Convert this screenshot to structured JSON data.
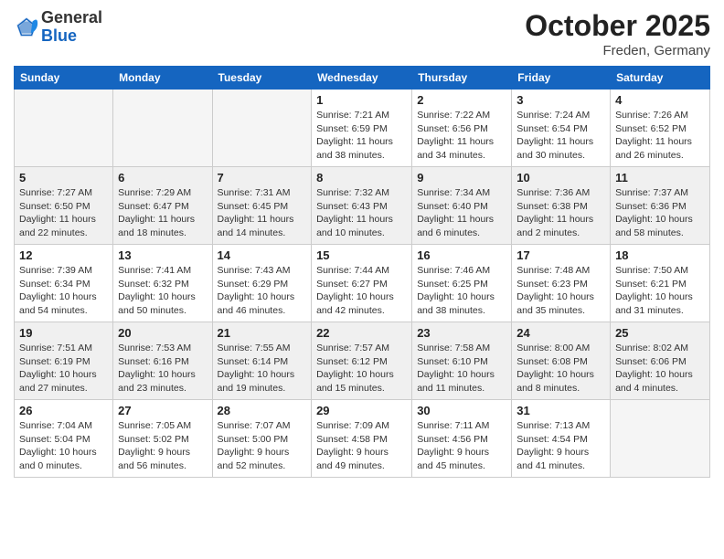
{
  "header": {
    "logo_general": "General",
    "logo_blue": "Blue",
    "month": "October 2025",
    "location": "Freden, Germany"
  },
  "days_of_week": [
    "Sunday",
    "Monday",
    "Tuesday",
    "Wednesday",
    "Thursday",
    "Friday",
    "Saturday"
  ],
  "weeks": [
    {
      "shaded": false,
      "days": [
        {
          "num": "",
          "info": ""
        },
        {
          "num": "",
          "info": ""
        },
        {
          "num": "",
          "info": ""
        },
        {
          "num": "1",
          "info": "Sunrise: 7:21 AM\nSunset: 6:59 PM\nDaylight: 11 hours\nand 38 minutes."
        },
        {
          "num": "2",
          "info": "Sunrise: 7:22 AM\nSunset: 6:56 PM\nDaylight: 11 hours\nand 34 minutes."
        },
        {
          "num": "3",
          "info": "Sunrise: 7:24 AM\nSunset: 6:54 PM\nDaylight: 11 hours\nand 30 minutes."
        },
        {
          "num": "4",
          "info": "Sunrise: 7:26 AM\nSunset: 6:52 PM\nDaylight: 11 hours\nand 26 minutes."
        }
      ]
    },
    {
      "shaded": true,
      "days": [
        {
          "num": "5",
          "info": "Sunrise: 7:27 AM\nSunset: 6:50 PM\nDaylight: 11 hours\nand 22 minutes."
        },
        {
          "num": "6",
          "info": "Sunrise: 7:29 AM\nSunset: 6:47 PM\nDaylight: 11 hours\nand 18 minutes."
        },
        {
          "num": "7",
          "info": "Sunrise: 7:31 AM\nSunset: 6:45 PM\nDaylight: 11 hours\nand 14 minutes."
        },
        {
          "num": "8",
          "info": "Sunrise: 7:32 AM\nSunset: 6:43 PM\nDaylight: 11 hours\nand 10 minutes."
        },
        {
          "num": "9",
          "info": "Sunrise: 7:34 AM\nSunset: 6:40 PM\nDaylight: 11 hours\nand 6 minutes."
        },
        {
          "num": "10",
          "info": "Sunrise: 7:36 AM\nSunset: 6:38 PM\nDaylight: 11 hours\nand 2 minutes."
        },
        {
          "num": "11",
          "info": "Sunrise: 7:37 AM\nSunset: 6:36 PM\nDaylight: 10 hours\nand 58 minutes."
        }
      ]
    },
    {
      "shaded": false,
      "days": [
        {
          "num": "12",
          "info": "Sunrise: 7:39 AM\nSunset: 6:34 PM\nDaylight: 10 hours\nand 54 minutes."
        },
        {
          "num": "13",
          "info": "Sunrise: 7:41 AM\nSunset: 6:32 PM\nDaylight: 10 hours\nand 50 minutes."
        },
        {
          "num": "14",
          "info": "Sunrise: 7:43 AM\nSunset: 6:29 PM\nDaylight: 10 hours\nand 46 minutes."
        },
        {
          "num": "15",
          "info": "Sunrise: 7:44 AM\nSunset: 6:27 PM\nDaylight: 10 hours\nand 42 minutes."
        },
        {
          "num": "16",
          "info": "Sunrise: 7:46 AM\nSunset: 6:25 PM\nDaylight: 10 hours\nand 38 minutes."
        },
        {
          "num": "17",
          "info": "Sunrise: 7:48 AM\nSunset: 6:23 PM\nDaylight: 10 hours\nand 35 minutes."
        },
        {
          "num": "18",
          "info": "Sunrise: 7:50 AM\nSunset: 6:21 PM\nDaylight: 10 hours\nand 31 minutes."
        }
      ]
    },
    {
      "shaded": true,
      "days": [
        {
          "num": "19",
          "info": "Sunrise: 7:51 AM\nSunset: 6:19 PM\nDaylight: 10 hours\nand 27 minutes."
        },
        {
          "num": "20",
          "info": "Sunrise: 7:53 AM\nSunset: 6:16 PM\nDaylight: 10 hours\nand 23 minutes."
        },
        {
          "num": "21",
          "info": "Sunrise: 7:55 AM\nSunset: 6:14 PM\nDaylight: 10 hours\nand 19 minutes."
        },
        {
          "num": "22",
          "info": "Sunrise: 7:57 AM\nSunset: 6:12 PM\nDaylight: 10 hours\nand 15 minutes."
        },
        {
          "num": "23",
          "info": "Sunrise: 7:58 AM\nSunset: 6:10 PM\nDaylight: 10 hours\nand 11 minutes."
        },
        {
          "num": "24",
          "info": "Sunrise: 8:00 AM\nSunset: 6:08 PM\nDaylight: 10 hours\nand 8 minutes."
        },
        {
          "num": "25",
          "info": "Sunrise: 8:02 AM\nSunset: 6:06 PM\nDaylight: 10 hours\nand 4 minutes."
        }
      ]
    },
    {
      "shaded": false,
      "days": [
        {
          "num": "26",
          "info": "Sunrise: 7:04 AM\nSunset: 5:04 PM\nDaylight: 10 hours\nand 0 minutes."
        },
        {
          "num": "27",
          "info": "Sunrise: 7:05 AM\nSunset: 5:02 PM\nDaylight: 9 hours\nand 56 minutes."
        },
        {
          "num": "28",
          "info": "Sunrise: 7:07 AM\nSunset: 5:00 PM\nDaylight: 9 hours\nand 52 minutes."
        },
        {
          "num": "29",
          "info": "Sunrise: 7:09 AM\nSunset: 4:58 PM\nDaylight: 9 hours\nand 49 minutes."
        },
        {
          "num": "30",
          "info": "Sunrise: 7:11 AM\nSunset: 4:56 PM\nDaylight: 9 hours\nand 45 minutes."
        },
        {
          "num": "31",
          "info": "Sunrise: 7:13 AM\nSunset: 4:54 PM\nDaylight: 9 hours\nand 41 minutes."
        },
        {
          "num": "",
          "info": ""
        }
      ]
    }
  ]
}
